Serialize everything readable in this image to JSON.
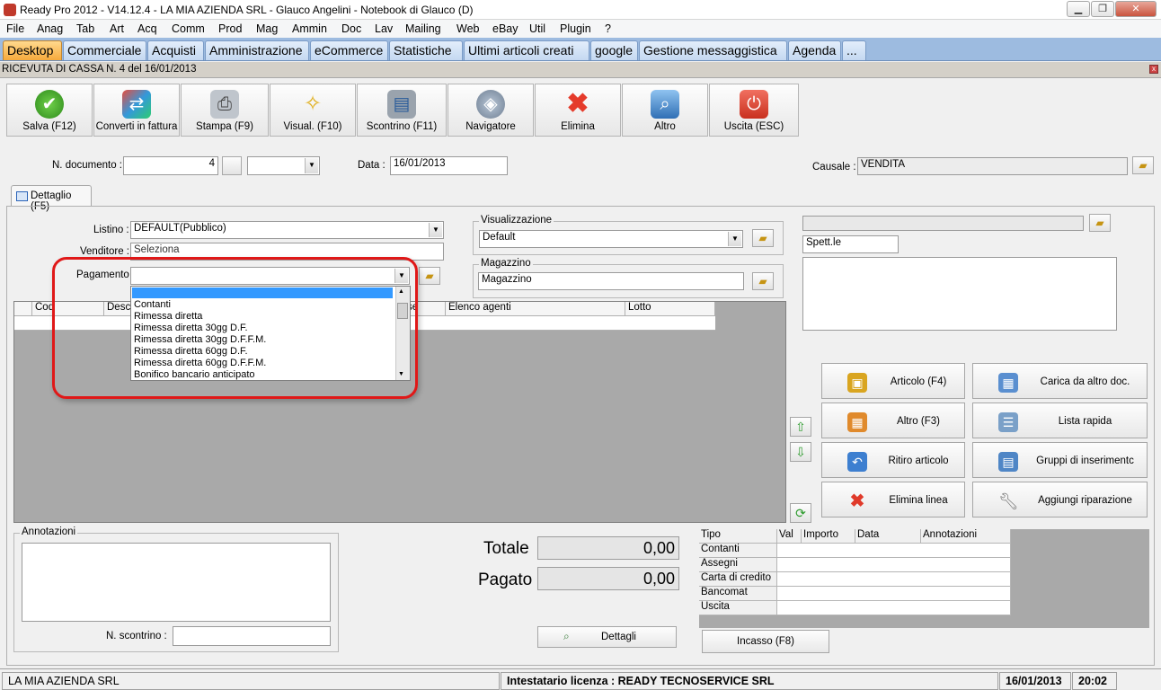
{
  "window": {
    "title": "Ready Pro 2012 - V14.12.4 - LA MIA AZIENDA SRL - Glauco Angelini - Notebook di Glauco (D)",
    "min": "▁",
    "max": "❐",
    "close": "✕"
  },
  "menu": [
    "File",
    "Anag",
    "Tab",
    "Art",
    "Acq",
    "Comm",
    "Prod",
    "Mag",
    "Ammin",
    "Doc",
    "Lav",
    "Mailing",
    "Web",
    "eBay",
    "Util",
    "Plugin",
    "?"
  ],
  "tabs": [
    {
      "label": "Desktop",
      "active": true
    },
    {
      "label": "Commerciale"
    },
    {
      "label": "Acquisti"
    },
    {
      "label": "Amministrazione"
    },
    {
      "label": "eCommerce"
    },
    {
      "label": "Statistiche"
    },
    {
      "label": "Ultimi articoli creati"
    },
    {
      "label": "google"
    },
    {
      "label": "Gestione messaggistica"
    },
    {
      "label": "Agenda"
    },
    {
      "label": "..."
    }
  ],
  "document": {
    "title": "RICEVUTA DI CASSA N. 4  del 16/01/2013"
  },
  "toolbar": [
    {
      "label": "Salva (F12)",
      "icon": "check-icon"
    },
    {
      "label": "Converti in fattura",
      "icon": "convert-icon"
    },
    {
      "label": "Stampa (F9)",
      "icon": "printer-icon"
    },
    {
      "label": "Visual. (F10)",
      "icon": "wand-icon"
    },
    {
      "label": "Scontrino (F11)",
      "icon": "cash-register-icon"
    },
    {
      "label": "Navigatore",
      "icon": "compass-icon"
    },
    {
      "label": "Elimina",
      "icon": "delete-x-icon"
    },
    {
      "label": "Altro",
      "icon": "magnifier-icon"
    },
    {
      "label": "Uscita (ESC)",
      "icon": "power-icon"
    }
  ],
  "header": {
    "ndoc_label": "N. documento :",
    "ndoc_value": "4",
    "data_label": "Data :",
    "data_value": "16/01/2013",
    "causale_label": "Causale :",
    "causale_value": "VENDITA"
  },
  "detail_tab": "Dettaglio (F5)",
  "form": {
    "listino_label": "Listino :",
    "listino_value": "DEFAULT(Pubblico)",
    "venditore_label": "Venditore :",
    "venditore_value": "Seleziona",
    "pagamento_label": "Pagamento :",
    "pagamento_value": ""
  },
  "visualizzazione": {
    "legend": "Visualizzazione",
    "value": "Default"
  },
  "magazzino": {
    "legend": "Magazzino",
    "value": "Magazzino"
  },
  "customer": {
    "spett": "Spett.le"
  },
  "payment_options": [
    "Contanti",
    "Rimessa diretta",
    "Rimessa diretta 30gg D.F.",
    "Rimessa diretta 30gg D.F.F.M.",
    "Rimessa diretta 60gg D.F.",
    "Rimessa diretta 60gg D.F.F.M.",
    "Bonifico bancario anticipato"
  ],
  "grid_headers": [
    "Cod",
    "Desc",
    "se",
    "Elenco agenti",
    "Lotto"
  ],
  "actions": [
    {
      "label": "Articolo (F4)",
      "icon": "box-add-icon",
      "color": "#d9a520"
    },
    {
      "label": "Carica da altro doc.",
      "icon": "table-check-icon",
      "color": "#5a8fd0"
    },
    {
      "label": "Altro (F3)",
      "icon": "grid-add-icon",
      "color": "#e08a2c"
    },
    {
      "label": "Lista rapida",
      "icon": "list-add-icon",
      "color": "#7aa0c8"
    },
    {
      "label": "Ritiro articolo",
      "icon": "undo-arrow-icon",
      "color": "#3d7fd0"
    },
    {
      "label": "Gruppi di inserimentc",
      "icon": "group-add-icon",
      "color": "#4f86c6"
    },
    {
      "label": "Elimina linea",
      "icon": "delete-x-icon",
      "color": "#e03a2a"
    },
    {
      "label": "Aggiungi riparazione",
      "icon": "wrench-icon",
      "color": "#8a8a8a"
    }
  ],
  "annotazioni": {
    "legend": "Annotazioni",
    "scontrino_label": "N. scontrino :"
  },
  "totals": {
    "totale_label": "Totale",
    "totale_value": "0,00",
    "pagato_label": "Pagato",
    "pagato_value": "0,00",
    "dettagli_label": "Dettagli"
  },
  "payment_table": {
    "headers": [
      "Tipo",
      "Val",
      "Importo",
      "Data",
      "Annotazioni"
    ],
    "rows": [
      "Contanti",
      "Assegni",
      "Carta di credito",
      "Bancomat",
      "Uscita"
    ]
  },
  "incasso_label": "Incasso (F8)",
  "status": {
    "company": "LA MIA AZIENDA SRL",
    "license": "Intestatario licenza : READY TECNOSERVICE SRL",
    "date": "16/01/2013",
    "time": "20:02"
  }
}
